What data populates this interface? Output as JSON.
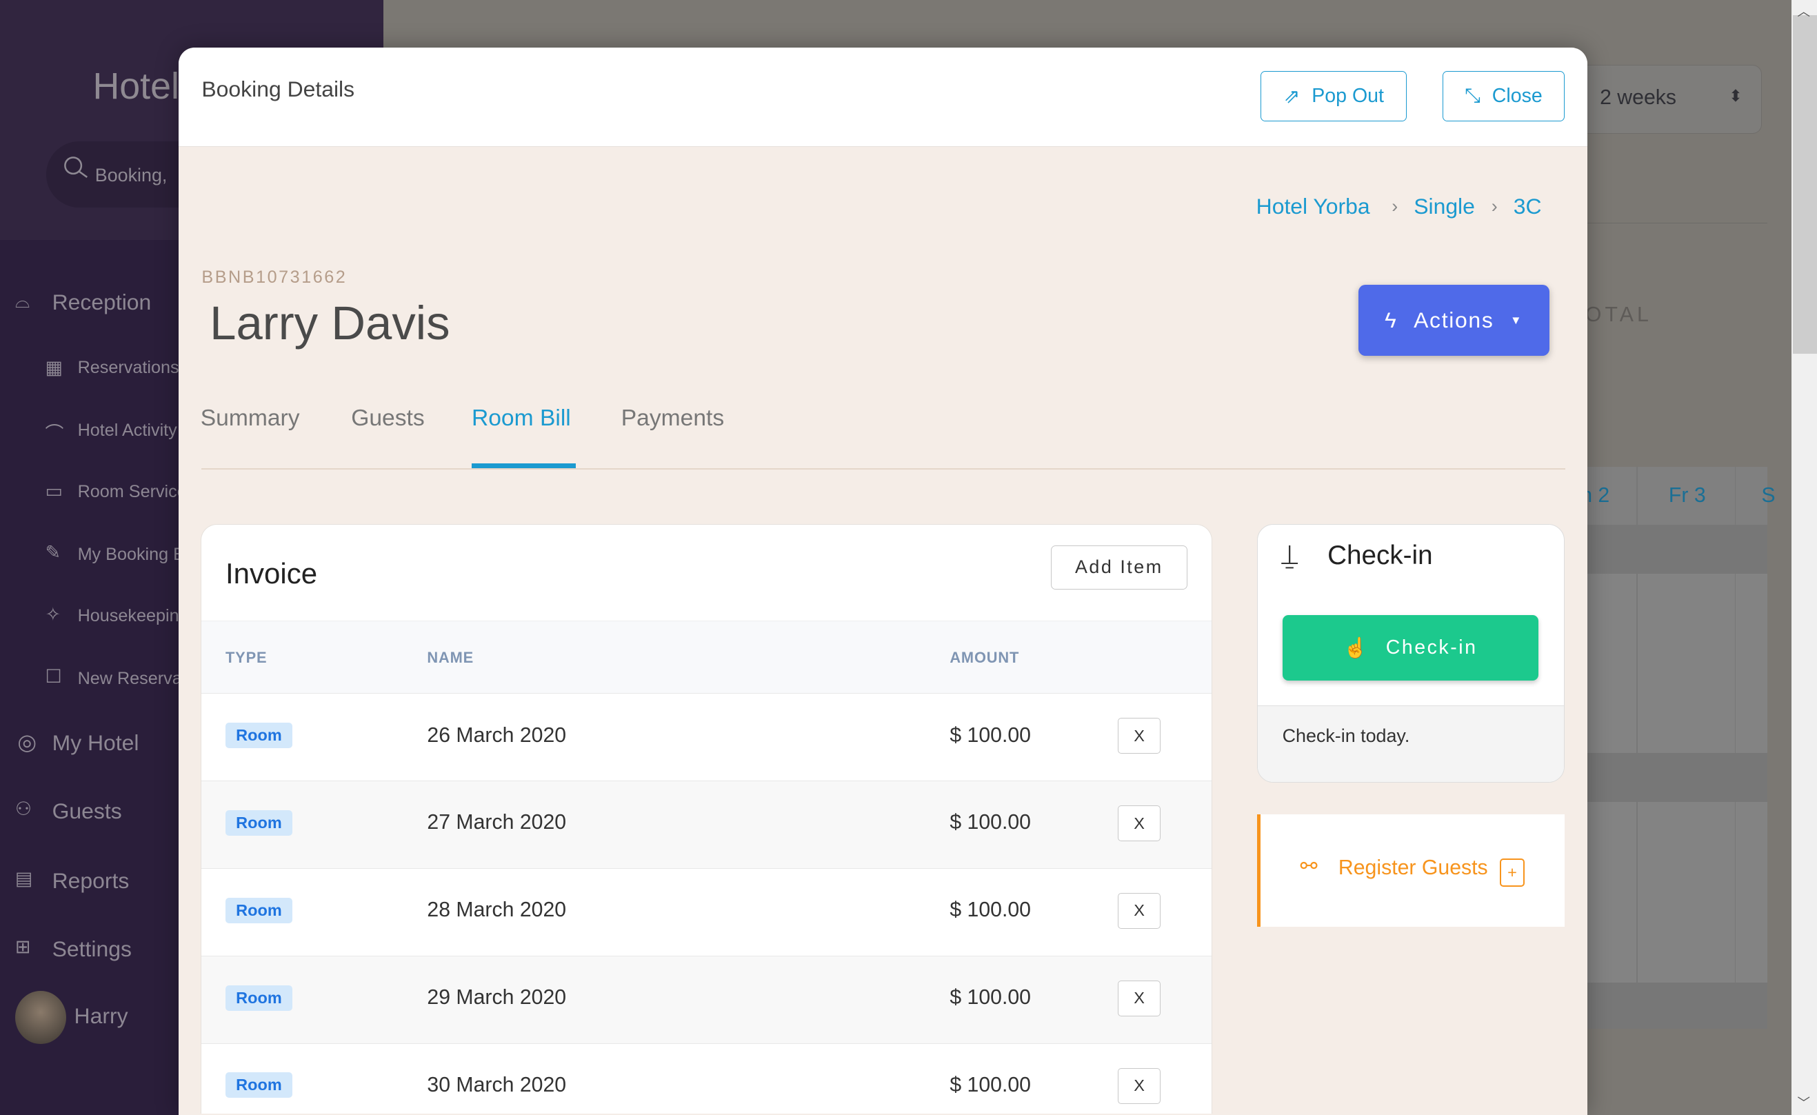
{
  "sidebar": {
    "brand": "Hotel",
    "search_placeholder": "Booking,",
    "items": [
      {
        "label": "Reception",
        "icon": "bell-icon"
      },
      {
        "label": "Reservations",
        "icon": "calendar-icon"
      },
      {
        "label": "Hotel Activity",
        "icon": "inbox-icon"
      },
      {
        "label": "Room Service",
        "icon": "room-service-icon"
      },
      {
        "label": "My Booking E",
        "icon": "booking-icon"
      },
      {
        "label": "Housekeeping",
        "icon": "magic-wand-icon"
      },
      {
        "label": "New Reserva",
        "icon": "edit-icon"
      },
      {
        "label": "My Hotel",
        "icon": "map-pin-icon"
      },
      {
        "label": "Guests",
        "icon": "users-icon"
      },
      {
        "label": "Reports",
        "icon": "presentation-icon"
      },
      {
        "label": "Settings",
        "icon": "sliders-icon"
      }
    ],
    "user": "Harry"
  },
  "background": {
    "range_select": "2 weeks",
    "total_label": "OTAL",
    "day_headers": [
      "n 2",
      "Fr 3",
      "S"
    ]
  },
  "modal": {
    "title": "Booking Details",
    "pop_out": "Pop Out",
    "close": "Close",
    "breadcrumb": [
      "Hotel Yorba",
      "Single",
      "3C"
    ],
    "booking_ref": "BBNB10731662",
    "guest_name": "Larry Davis",
    "actions": "Actions",
    "tabs": [
      "Summary",
      "Guests",
      "Room Bill",
      "Payments"
    ],
    "active_tab": "Room Bill",
    "invoice": {
      "title": "Invoice",
      "add_item": "Add Item",
      "columns": [
        "TYPE",
        "NAME",
        "AMOUNT"
      ],
      "rows": [
        {
          "type": "Room",
          "name": "26 March 2020",
          "amount": "$ 100.00",
          "remove": "X"
        },
        {
          "type": "Room",
          "name": "27 March 2020",
          "amount": "$ 100.00",
          "remove": "X"
        },
        {
          "type": "Room",
          "name": "28 March 2020",
          "amount": "$ 100.00",
          "remove": "X"
        },
        {
          "type": "Room",
          "name": "29 March 2020",
          "amount": "$ 100.00",
          "remove": "X"
        },
        {
          "type": "Room",
          "name": "30 March 2020",
          "amount": "$ 100.00",
          "remove": "X"
        }
      ]
    },
    "checkin": {
      "title": "Check-in",
      "button": "Check-in",
      "note_prefix": "Check-in ",
      "note_highlight": "today",
      "note_suffix": "."
    },
    "register_guests": "Register Guests",
    "register_plus": "+"
  },
  "colors": {
    "accent": "#1b9ad0",
    "actions": "#4f6ae9",
    "checkin": "#1cc98d",
    "register": "#f7941d",
    "today": "#e64f8a"
  }
}
